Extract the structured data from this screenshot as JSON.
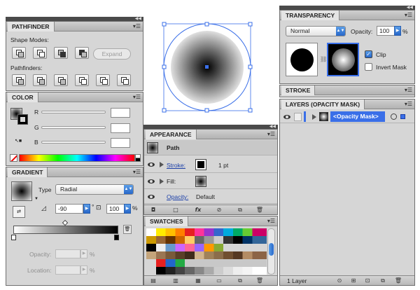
{
  "pathfinder": {
    "title": "PATHFINDER",
    "shape_modes_label": "Shape Modes:",
    "expand_label": "Expand",
    "pathfinders_label": "Pathfinders:"
  },
  "color": {
    "title": "COLOR",
    "r_label": "R",
    "g_label": "G",
    "b_label": "B"
  },
  "gradient": {
    "title": "GRADIENT",
    "type_label": "Type",
    "type_value": "Radial",
    "angle_value": "-90",
    "angle_unit": "°",
    "aspect_value": "100",
    "aspect_unit": "%",
    "opacity_label": "Opacity:",
    "opacity_unit": "%",
    "location_label": "Location:",
    "location_unit": "%"
  },
  "appearance": {
    "title": "APPEARANCE",
    "path_label": "Path",
    "stroke_label": "Stroke:",
    "stroke_value": "1 pt",
    "fill_label": "Fill:",
    "opacity_label": "Opacity:",
    "opacity_value": "Default"
  },
  "swatches": {
    "title": "SWATCHES"
  },
  "transparency": {
    "title": "TRANSPARENCY",
    "blend_mode": "Normal",
    "opacity_label": "Opacity:",
    "opacity_value": "100",
    "opacity_unit": "%",
    "clip_label": "Clip",
    "clip_checked": true,
    "invert_label": "Invert Mask",
    "invert_checked": false
  },
  "stroke": {
    "title": "STROKE"
  },
  "layers": {
    "title": "LAYERS (OPACITY MASK)",
    "item_label": "<Opacity Mask>",
    "count_label": "1 Layer"
  },
  "colors": {
    "selection_blue": "#3a6fe8",
    "panel_gray": "#d6d6d6",
    "link_blue": "#1b3fa8"
  }
}
